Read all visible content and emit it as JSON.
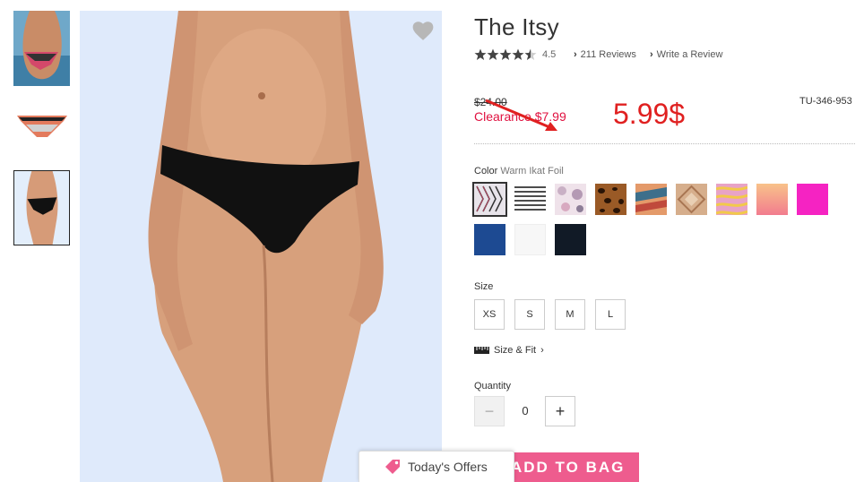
{
  "product": {
    "title": "The Itsy",
    "rating": "4.5",
    "stars": 4.5,
    "reviews_label": "211 Reviews",
    "write_review_label": "Write a Review",
    "old_price": "$24.00",
    "clearance_price": "Clearance $7.99",
    "sku": "TU-346-953",
    "annotation_price": "5.99$"
  },
  "color": {
    "label": "Color",
    "selected": "Warm Ikat Foil"
  },
  "swatches": [
    {
      "name": "Warm Ikat Foil",
      "color": "#e8e4ea"
    },
    {
      "name": "Stripe",
      "color": "#ffffff"
    },
    {
      "name": "Pink Floral",
      "color": "#efe2ea"
    },
    {
      "name": "Leopard",
      "color": "#9a5a26"
    },
    {
      "name": "Warm Abstract",
      "color": "#e49a6a"
    },
    {
      "name": "Tan Geo",
      "color": "#d6ae8c"
    },
    {
      "name": "Zebra Pink",
      "color": "#e8a3c6"
    },
    {
      "name": "Coral Ombre",
      "color": "#f2a79a"
    },
    {
      "name": "Hot Pink",
      "color": "#f523c2"
    },
    {
      "name": "Navy",
      "color": "#1d4a92"
    },
    {
      "name": "White",
      "color": "#f7f7f7"
    },
    {
      "name": "Black",
      "color": "#111a26"
    }
  ],
  "size": {
    "label": "Size",
    "options": [
      "XS",
      "S",
      "M",
      "L"
    ],
    "fit_label": "Size & Fit"
  },
  "quantity": {
    "label": "Quantity",
    "value": "0",
    "minus": "−",
    "plus": "+"
  },
  "add_to_bag_label": "ADD TO BAG",
  "offers_label": "Today's Offers",
  "colors": {
    "accent_pink": "#ee5c8e",
    "sale_red": "#e0103f",
    "annotation_red": "#e02020"
  }
}
